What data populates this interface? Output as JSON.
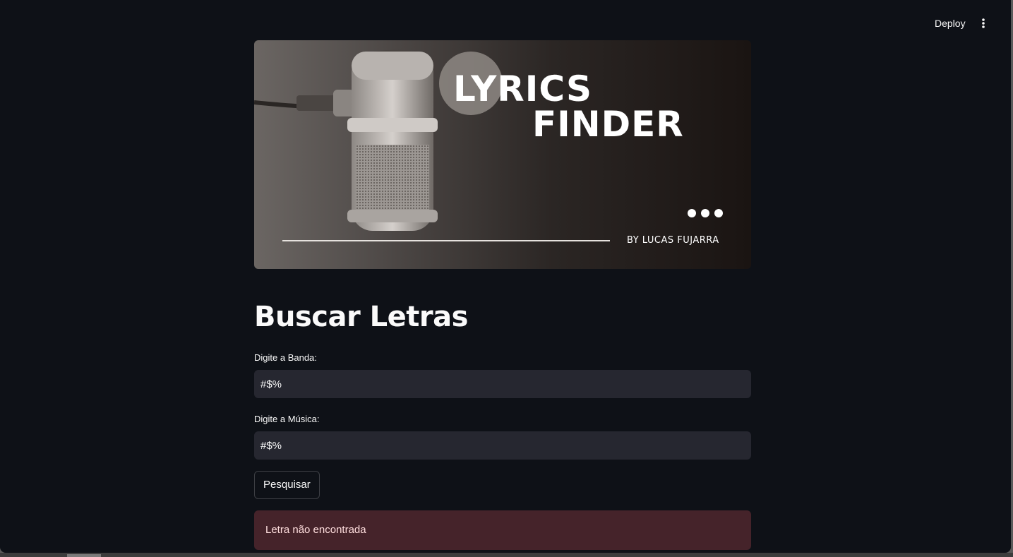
{
  "header": {
    "deploy_label": "Deploy",
    "menu_icon": "vertical-dots-icon"
  },
  "banner": {
    "title_line1": "LYRICS",
    "title_line2": "FINDER",
    "byline": "BY LUCAS FUJARRA"
  },
  "page": {
    "title": "Buscar Letras"
  },
  "form": {
    "band_label": "Digite a Banda:",
    "band_value": "#$%",
    "song_label": "Digite a Música:",
    "song_value": "#$%",
    "search_label": "Pesquisar"
  },
  "alert": {
    "message": "Letra não encontrada"
  },
  "colors": {
    "background": "#0e1117",
    "input_bg": "#262730",
    "error_bg": "#45232a",
    "error_text": "#ffdede",
    "text": "#fafafa"
  }
}
